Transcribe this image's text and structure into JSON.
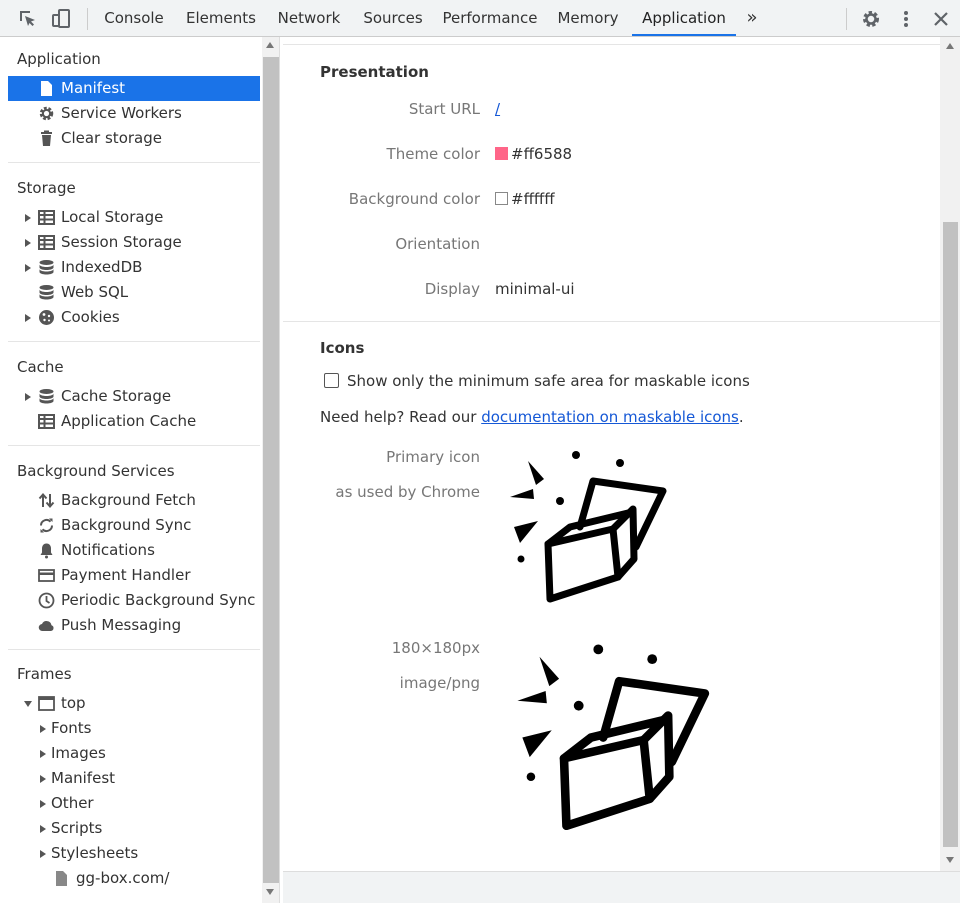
{
  "toolbar": {
    "tabs": [
      "Console",
      "Elements",
      "Network",
      "Sources",
      "Performance",
      "Memory",
      "Application"
    ],
    "active_tab": "Application",
    "more_tabs": "»"
  },
  "sidebar": {
    "application": {
      "title": "Application",
      "items": [
        "Manifest",
        "Service Workers",
        "Clear storage"
      ]
    },
    "storage": {
      "title": "Storage",
      "items": [
        "Local Storage",
        "Session Storage",
        "IndexedDB",
        "Web SQL",
        "Cookies"
      ]
    },
    "cache": {
      "title": "Cache",
      "items": [
        "Cache Storage",
        "Application Cache"
      ]
    },
    "background": {
      "title": "Background Services",
      "items": [
        "Background Fetch",
        "Background Sync",
        "Notifications",
        "Payment Handler",
        "Periodic Background Sync",
        "Push Messaging"
      ]
    },
    "frames": {
      "title": "Frames",
      "top": "top",
      "children": [
        "Fonts",
        "Images",
        "Manifest",
        "Other",
        "Scripts",
        "Stylesheets"
      ],
      "doc": "gg-box.com/"
    }
  },
  "presentation": {
    "title": "Presentation",
    "start_url_label": "Start URL",
    "start_url": "/",
    "theme_color_label": "Theme color",
    "theme_color": "#ff6588",
    "background_color_label": "Background color",
    "background_color": "#ffffff",
    "orientation_label": "Orientation",
    "orientation": "",
    "display_label": "Display",
    "display": "minimal-ui"
  },
  "icons": {
    "title": "Icons",
    "checkbox_label": "Show only the minimum safe area for maskable icons",
    "checkbox_checked": false,
    "help_prefix": "Need help? Read our ",
    "help_link": "documentation on maskable icons",
    "help_suffix": ".",
    "primary_label": "Primary icon",
    "primary_sub": "as used by Chrome",
    "size_label": "180×180px",
    "type_label": "image/png"
  }
}
